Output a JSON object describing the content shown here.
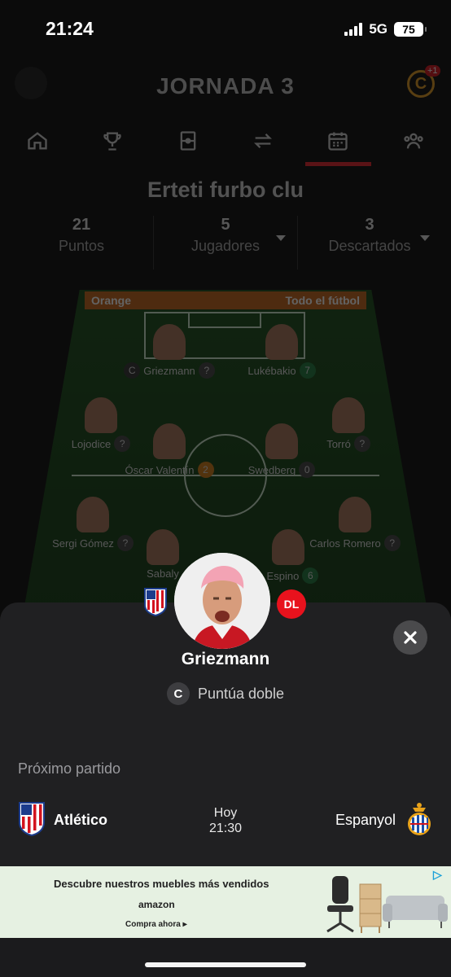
{
  "status_bar": {
    "time": "21:24",
    "network": "5G",
    "battery": "75"
  },
  "header": {
    "round_title": "JORNADA 3",
    "coin_badge": "+1"
  },
  "nav_tabs": [
    "home",
    "trophy",
    "lineup",
    "transfers",
    "calendar",
    "users"
  ],
  "team": {
    "name": "Erteti furbo clu"
  },
  "stats": [
    {
      "value": "21",
      "label": "Puntos"
    },
    {
      "value": "5",
      "label": "Jugadores"
    },
    {
      "value": "3",
      "label": "Descartados"
    }
  ],
  "sponsor": {
    "left": "Orange",
    "right": "Todo el fútbol"
  },
  "lineup": [
    {
      "name": "Griezmann",
      "points": "?",
      "captain": "C"
    },
    {
      "name": "Lukébakio",
      "points": "7"
    },
    {
      "name": "Lojodice",
      "points": "?"
    },
    {
      "name": "Torró",
      "points": "?"
    },
    {
      "name": "Óscar Valentín",
      "points": "2"
    },
    {
      "name": "Swedberg",
      "points": "0"
    },
    {
      "name": "Sergi Gómez",
      "points": "?"
    },
    {
      "name": "Carlos Romero",
      "points": "?"
    },
    {
      "name": "Sabaly",
      "points": ""
    },
    {
      "name": "a Espino",
      "points": "6"
    }
  ],
  "sheet": {
    "position_badge": "DL",
    "player_name": "Griezmann",
    "role_badge": "C",
    "role_text": "Puntúa doble",
    "next_label": "Próximo partido",
    "home_team": "Atlético",
    "day": "Hoy",
    "time": "21:30",
    "away_team": "Espanyol"
  },
  "ad": {
    "headline": "Descubre nuestros muebles más vendidos",
    "brand": "amazon",
    "cta": "Compra ahora ▸",
    "info_icon": "▷"
  }
}
